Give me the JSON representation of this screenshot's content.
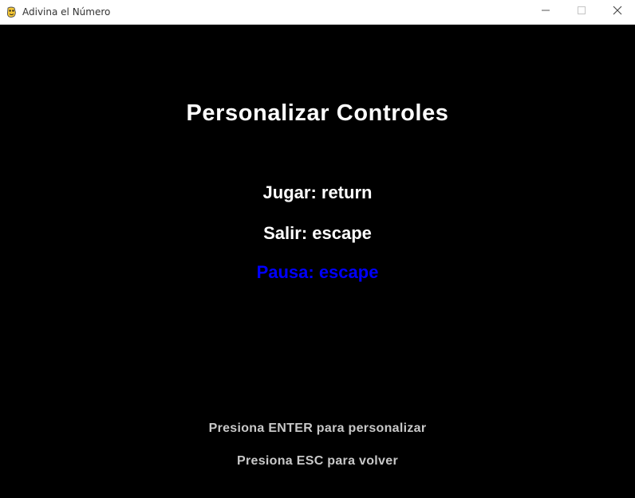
{
  "window": {
    "title": "Adivina el Número",
    "icons": {
      "app": "pygame-snake-icon",
      "minimize": "minimize-icon",
      "maximize": "maximize-icon",
      "close": "close-icon"
    }
  },
  "screen": {
    "heading": "Personalizar Controles",
    "options": [
      {
        "label": "Jugar: return",
        "selected": false
      },
      {
        "label": "Salir: escape",
        "selected": false
      },
      {
        "label": "Pausa: escape",
        "selected": true
      }
    ],
    "hints": {
      "enter": "Presiona ENTER para personalizar",
      "esc": "Presiona ESC para volver"
    }
  },
  "colors": {
    "background": "#000000",
    "text": "#ffffff",
    "selected": "#0000ff",
    "hint": "#c8c8c8"
  }
}
